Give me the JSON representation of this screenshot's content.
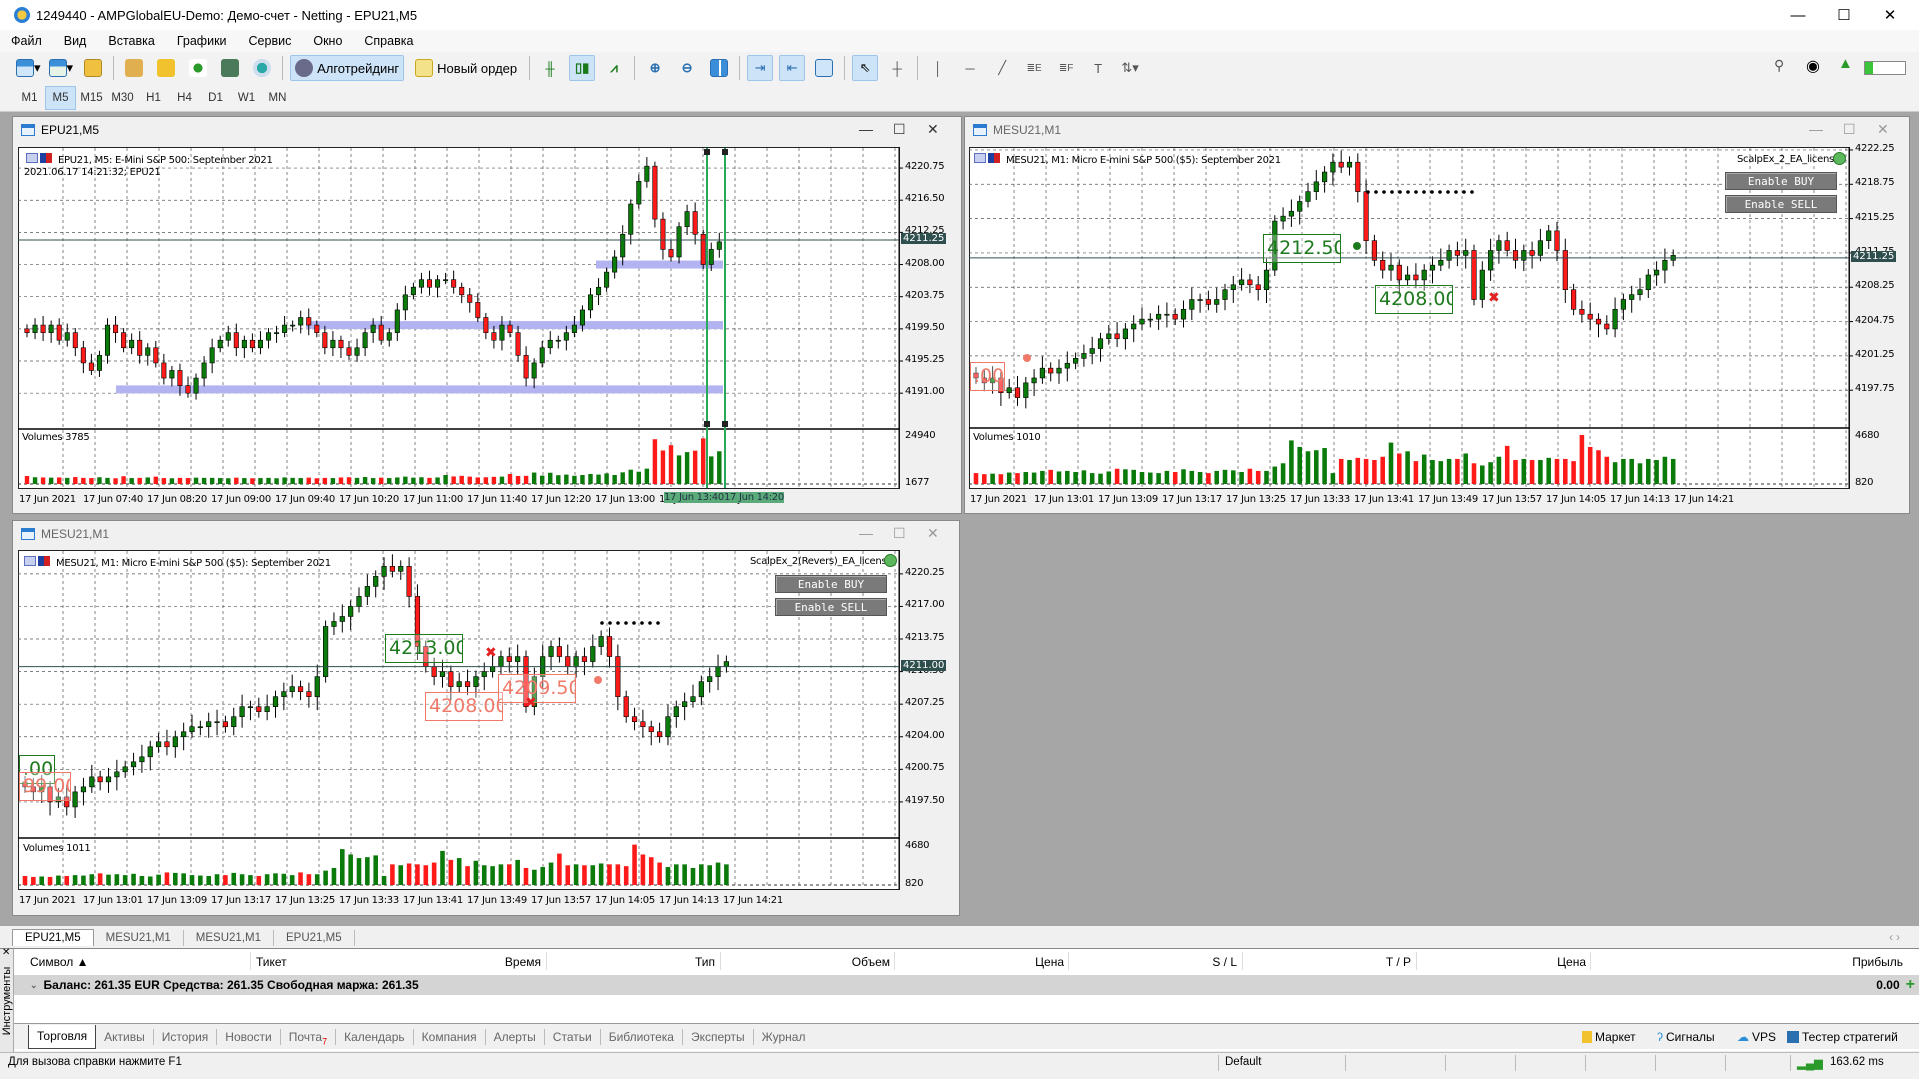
{
  "window": {
    "title": "1249440 - AMPGlobalEU-Demo: Демо-счет - Netting - EPU21,M5"
  },
  "menu": [
    "Файл",
    "Вид",
    "Вставка",
    "Графики",
    "Сервис",
    "Окно",
    "Справка"
  ],
  "toolbar": {
    "algo_label": "Алготрейдинг",
    "new_order_label": "Новый ордер"
  },
  "timeframes": {
    "items": [
      "M1",
      "M5",
      "M15",
      "M30",
      "H1",
      "H4",
      "D1",
      "W1",
      "MN"
    ],
    "active": "M5"
  },
  "charts": [
    {
      "window_title": "EPU21,M5",
      "header": "EPU21, M5:  E-Mini S&P 500: September 2021",
      "subheader": "2021.06.17 14:21:32; EPU21",
      "ylim": [
        4186.4,
        4223.4
      ],
      "price_ticks": [
        "4220.75",
        "4216.50",
        "4212.25",
        "4208.00",
        "4203.75",
        "4199.50",
        "4195.25",
        "4191.00"
      ],
      "current_price": "4211.25",
      "volume_label": "Volumes 3785",
      "volume_ticks": [
        "24940",
        "1677"
      ],
      "vol_max": 24940,
      "time_labels": [
        "17 Jun 2021",
        "17 Jun 07:40",
        "17 Jun 08:20",
        "17 Jun 09:00",
        "17 Jun 09:40",
        "17 Jun 10:20",
        "17 Jun 11:00",
        "17 Jun 11:40",
        "17 Jun 12:20",
        "17 Jun 13:00",
        "17 Jun 13:40",
        "17 Jun 14:20"
      ],
      "highlight_times": [
        "17 Jun 13:40",
        "17 Jun 14:20"
      ],
      "zones": [
        4191.5,
        4200.0,
        4208.0
      ],
      "closes": [
        4199,
        4200,
        4199,
        4200,
        4198,
        4199,
        4197,
        4195,
        4194,
        4196,
        4200,
        4199,
        4197,
        4198,
        4196,
        4197,
        4195,
        4193,
        4194,
        4192,
        4191,
        4193,
        4195,
        4197,
        4198,
        4199,
        4197,
        4198,
        4197,
        4198,
        4199,
        4199,
        4200,
        4200,
        4201,
        4200,
        4199,
        4197,
        4198,
        4197,
        4196,
        4197,
        4199,
        4200,
        4198,
        4199,
        4202,
        4204,
        4205,
        4206,
        4205,
        4206,
        4206,
        4205,
        4204,
        4203,
        4201,
        4199,
        4198,
        4200,
        4199,
        4196,
        4193,
        4195,
        4197,
        4198,
        4198,
        4199,
        4200,
        4202,
        4204,
        4205,
        4207,
        4209,
        4212,
        4216,
        4219,
        4221,
        4214,
        4210,
        4209,
        4213,
        4215,
        4212,
        4208,
        4210,
        4211
      ],
      "volumes": [
        3900,
        3300,
        3200,
        3100,
        3200,
        3000,
        3400,
        3000,
        2900,
        3300,
        3000,
        2800,
        3800,
        2900,
        3000,
        3200,
        3600,
        2900,
        2800,
        3000,
        2900,
        3100,
        3000,
        3000,
        2900,
        2800,
        3100,
        2900,
        2800,
        2900,
        3000,
        2800,
        3200,
        3000,
        2900,
        3100,
        2800,
        3000,
        2900,
        3200,
        3300,
        3000,
        3400,
        2900,
        3100,
        2900,
        3200,
        3600,
        3100,
        3300,
        3000,
        3200,
        4400,
        3700,
        4000,
        3600,
        3200,
        3300,
        3500,
        3600,
        4900,
        3900,
        4000,
        5600,
        4100,
        5500,
        4300,
        4600,
        4000,
        4400,
        4900,
        4600,
        5200,
        4400,
        5700,
        7000,
        6000,
        7500,
        21900,
        16400,
        19000,
        14000,
        15600,
        16300,
        22300,
        13500,
        16000,
        5500
      ]
    },
    {
      "window_title": "MESU21,M1",
      "header": "MESU21, M1:  Micro E-mini S&P 500 ($5): September 2021",
      "ea_name": "ScalpEx_2_EA_license",
      "buy_label": "Enable BUY",
      "sell_label": "Enable SELL",
      "ylim": [
        4194.0,
        4222.45
      ],
      "price_ticks": [
        "4222.25",
        "4218.75",
        "4215.25",
        "4211.75",
        "4208.25",
        "4204.75",
        "4201.25",
        "4197.75"
      ],
      "current_price": "4211.25",
      "volume_label": "Volumes 1010",
      "volume_ticks": [
        "4680",
        "820"
      ],
      "vol_max": 4680,
      "time_labels": [
        "17 Jun 2021",
        "17 Jun 13:01",
        "17 Jun 13:09",
        "17 Jun 13:17",
        "17 Jun 13:25",
        "17 Jun 13:33",
        "17 Jun 13:41",
        "17 Jun 13:49",
        "17 Jun 13:57",
        "17 Jun 14:05",
        "17 Jun 14:13",
        "17 Jun 14:21"
      ],
      "trade_labels": [
        {
          "text": "4212.50",
          "color": "green"
        },
        {
          "text": "4208.00",
          "color": "green"
        },
        {
          "text": ".00",
          "color": "red"
        }
      ]
    },
    {
      "window_title": "MESU21,M1",
      "header": "MESU21, M1:  Micro E-mini S&P 500 ($5): September 2021",
      "ea_name": "ScalpEx_2(Revers)_EA_license",
      "buy_label": "Enable BUY",
      "sell_label": "Enable SELL",
      "ylim": [
        4194.0,
        4222.53
      ],
      "price_ticks": [
        "4220.25",
        "4217.00",
        "4213.75",
        "4210.50",
        "4207.25",
        "4204.00",
        "4200.75",
        "4197.50"
      ],
      "current_price": "4211.00",
      "volume_label": "Volumes 1011",
      "volume_ticks": [
        "4680",
        "820"
      ],
      "vol_max": 4680,
      "time_labels": [
        "17 Jun 2021",
        "17 Jun 13:01",
        "17 Jun 13:09",
        "17 Jun 13:17",
        "17 Jun 13:25",
        "17 Jun 13:33",
        "17 Jun 13:41",
        "17 Jun 13:49",
        "17 Jun 13:57",
        "17 Jun 14:05",
        "17 Jun 14:13",
        "17 Jun 14:21"
      ],
      "trade_labels": [
        {
          "text": "4213.00",
          "color": "green"
        },
        {
          "text": "4208.00",
          "color": "red"
        },
        {
          "text": "4209.50",
          "color": "red"
        },
        {
          "text": ".00",
          "color": "green"
        },
        {
          "text": "99.00",
          "color": "red"
        }
      ]
    }
  ],
  "mesu_series": {
    "closes": [
      4199,
      4198.5,
      4199,
      4197.5,
      4198,
      4197,
      4198.5,
      4199,
      4200,
      4199.5,
      4200,
      4200.5,
      4201,
      4201.5,
      4202,
      4203,
      4203.5,
      4203,
      4204,
      4204.5,
      4205,
      4205,
      4205.5,
      4205.5,
      4205,
      4206,
      4207,
      4207,
      4206.5,
      4207,
      4208,
      4208.5,
      4209,
      4208.5,
      4208,
      4210,
      4215,
      4215.5,
      4216,
      4217,
      4218,
      4219,
      4220,
      4221,
      4220.5,
      4221,
      4218,
      4213,
      4211,
      4210,
      4210.5,
      4209,
      4209.5,
      4209,
      4210,
      4210.5,
      4211,
      4212,
      4211.5,
      4212,
      4207,
      4210,
      4212,
      4213,
      4212,
      4211,
      4212,
      4211.5,
      4213,
      4214,
      4212,
      4208,
      4206,
      4205.5,
      4205,
      4204.5,
      4204,
      4206,
      4207,
      4207.5,
      4208,
      4209.5,
      4210,
      4211,
      4211.5
    ],
    "volumes": [
      1000,
      900,
      950,
      900,
      1050,
      1000,
      1100,
      1050,
      1200,
      1300,
      1150,
      1200,
      1100,
      1250,
      1000,
      950,
      1150,
      1400,
      1350,
      1300,
      1100,
      1050,
      1000,
      1200,
      1100,
      1350,
      1200,
      1100,
      1000,
      1200,
      1300,
      1250,
      1100,
      1400,
      1200,
      1200,
      1600,
      1900,
      4000,
      3400,
      3000,
      3100,
      3300,
      1000,
      2300,
      2200,
      2400,
      2300,
      2200,
      2500,
      3800,
      2800,
      3000,
      2100,
      2700,
      2200,
      2100,
      2300,
      2300,
      2800,
      1900,
      1700,
      2000,
      2500,
      3500,
      2200,
      2300,
      2200,
      2200,
      2400,
      2300,
      2300,
      2100,
      4500,
      3400,
      3100,
      2500,
      2000,
      2300,
      2300,
      1900,
      2300,
      2200,
      2500,
      2300
    ]
  },
  "chart_tabs": {
    "items": [
      "EPU21,M5",
      "MESU21,M1",
      "MESU21,M1",
      "EPU21,M5"
    ],
    "active": 0
  },
  "toolbox": {
    "side_label": "Инструменты",
    "columns": [
      "Символ ▲",
      "Тикет",
      "Время",
      "Тип",
      "Объем",
      "Цена",
      "S / L",
      "T / P",
      "Цена",
      "Прибыль"
    ],
    "balance_text": "Баланс: 261.35 EUR  Средства: 261.35  Свободная маржа: 261.35",
    "profit": "0.00",
    "tabs": [
      "Торговля",
      "Активы",
      "История",
      "Новости",
      "Почта",
      "Календарь",
      "Компания",
      "Алерты",
      "Статьи",
      "Библиотека",
      "Эксперты",
      "Журнал"
    ],
    "mail_badge": "7",
    "active_tab": 0,
    "right_items": [
      "Маркет",
      "Сигналы",
      "VPS",
      "Тестер стратегий"
    ]
  },
  "status": {
    "help": "Для вызова справки нажмите F1",
    "profile": "Default",
    "ping": "163.62 ms"
  },
  "colors": {
    "bull": "#0a7a0a",
    "bear": "#ff1a1a",
    "zone": "#b3b3f2",
    "grid": "#555555",
    "price_box": "#2f4f4f"
  }
}
